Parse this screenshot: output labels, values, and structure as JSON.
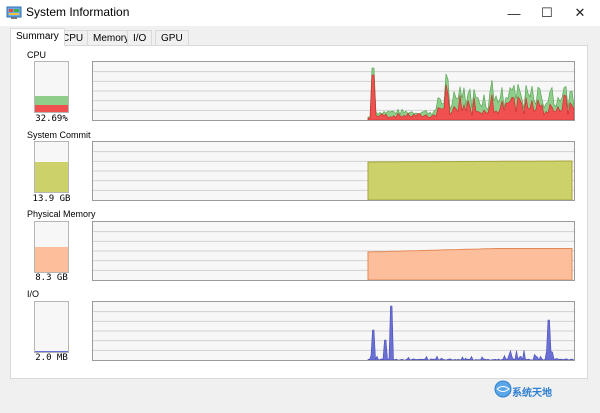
{
  "window": {
    "title": "System Information",
    "controls": {
      "minimize": "—",
      "maximize": "☐",
      "close": "✕"
    }
  },
  "tabs": [
    {
      "label": "Summary",
      "active": true
    },
    {
      "label": "CPU",
      "active": false
    },
    {
      "label": "Memory",
      "active": false
    },
    {
      "label": "I/O",
      "active": false
    },
    {
      "label": "GPU",
      "active": false
    }
  ],
  "sections": {
    "cpu": {
      "label": "CPU",
      "value": "32.69%",
      "level": 0.33
    },
    "commit": {
      "label": "System Commit",
      "value": "13.9 GB",
      "level": 0.6
    },
    "physical": {
      "label": "Physical Memory",
      "value": "8.3 GB",
      "level": 0.5
    },
    "io": {
      "label": "I/O",
      "value": "2.0  MB",
      "level": 0.03
    }
  },
  "colors": {
    "cpu_green": "#8fce8a",
    "cpu_red": "#f05050",
    "commit": "#cdd169",
    "commit_line": "#a3a63a",
    "physical": "#fdbf9b",
    "physical_line": "#e38a5a",
    "io": "#6a6fd6",
    "io_line": "#4a4fb6",
    "grid": "#d2d2d2"
  },
  "watermark": {
    "text": "系统天地"
  }
}
